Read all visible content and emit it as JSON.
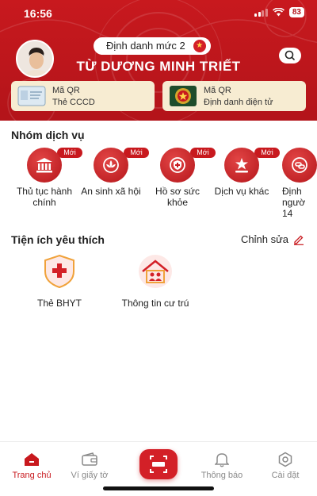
{
  "status_bar": {
    "time": "16:56",
    "battery": "83"
  },
  "header": {
    "id_level": "Định danh mức 2",
    "full_name": "TỪ DƯƠNG MINH TRIẾT",
    "qr_cards": [
      {
        "line1": "Mã QR",
        "line2": "Thẻ CCCD"
      },
      {
        "line1": "Mã QR",
        "line2": "Định danh điện tử"
      }
    ]
  },
  "services": {
    "title": "Nhóm dịch vụ",
    "badge": "Mới",
    "items": [
      {
        "label": "Thủ tục hành chính",
        "icon": "building-icon"
      },
      {
        "label": "An sinh xã hội",
        "icon": "lotus-icon"
      },
      {
        "label": "Hồ sơ sức khỏe",
        "icon": "medical-shield-icon"
      },
      {
        "label": "Dịch vụ khác",
        "icon": "star-podium-icon"
      },
      {
        "label": "Định ngườ 14",
        "icon": "link-icon"
      }
    ]
  },
  "favorites": {
    "title": "Tiện ích yêu thích",
    "edit_label": "Chỉnh sửa",
    "items": [
      {
        "label": "Thẻ BHYT",
        "icon": "health-insurance-icon"
      },
      {
        "label": "Thông tin cư trú",
        "icon": "residence-icon"
      }
    ]
  },
  "bottom_nav": {
    "items": [
      {
        "label": "Trang chủ",
        "icon": "home-icon",
        "active": true
      },
      {
        "label": "Ví giấy tờ",
        "icon": "wallet-icon",
        "active": false
      },
      {
        "label": "Thông báo",
        "icon": "bell-icon",
        "active": false
      },
      {
        "label": "Cài đặt",
        "icon": "settings-icon",
        "active": false
      }
    ]
  },
  "colors": {
    "primary": "#c8191e",
    "card_bg": "#f7ecd2",
    "gold": "#ffd54a"
  }
}
